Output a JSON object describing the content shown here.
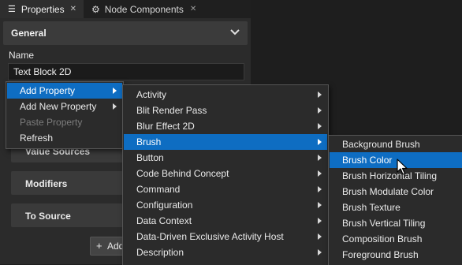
{
  "tabs": [
    {
      "label": "Properties",
      "icon": "list-icon",
      "active": true
    },
    {
      "label": "Node Components",
      "icon": "node-components-icon",
      "active": false
    }
  ],
  "general": {
    "title": "General"
  },
  "name_field": {
    "label": "Name",
    "value": "Text Block 2D"
  },
  "sections": {
    "value_sources": "Value Sources",
    "modifiers": "Modifiers",
    "to_source": "To Source"
  },
  "add_binding_button": {
    "label": "Add"
  },
  "context_menu": {
    "items": [
      {
        "label": "Add Property",
        "selected": true,
        "submenu": true
      },
      {
        "label": "Add New Property",
        "submenu": true
      },
      {
        "label": "Paste Property",
        "disabled": true
      },
      {
        "label": "Refresh"
      }
    ]
  },
  "property_menu": {
    "items": [
      {
        "label": "Activity",
        "submenu": true
      },
      {
        "label": "Blit Render Pass",
        "submenu": true
      },
      {
        "label": "Blur Effect 2D",
        "submenu": true
      },
      {
        "label": "Brush",
        "submenu": true,
        "selected": true
      },
      {
        "label": "Button",
        "submenu": true
      },
      {
        "label": "Code Behind Concept",
        "submenu": true
      },
      {
        "label": "Command",
        "submenu": true
      },
      {
        "label": "Configuration",
        "submenu": true
      },
      {
        "label": "Data Context",
        "submenu": true
      },
      {
        "label": "Data-Driven Exclusive Activity Host",
        "submenu": true
      },
      {
        "label": "Description",
        "submenu": true
      }
    ]
  },
  "brush_menu": {
    "items": [
      {
        "label": "Background Brush"
      },
      {
        "label": "Brush Color",
        "selected": true
      },
      {
        "label": "Brush Horizontal Tiling"
      },
      {
        "label": "Brush Modulate Color"
      },
      {
        "label": "Brush Texture"
      },
      {
        "label": "Brush Vertical Tiling"
      },
      {
        "label": "Composition Brush"
      },
      {
        "label": "Foreground Brush"
      }
    ]
  },
  "colors": {
    "accent": "#0e6dc2",
    "panel": "#2b2b2b",
    "header": "#3b3b3b"
  }
}
